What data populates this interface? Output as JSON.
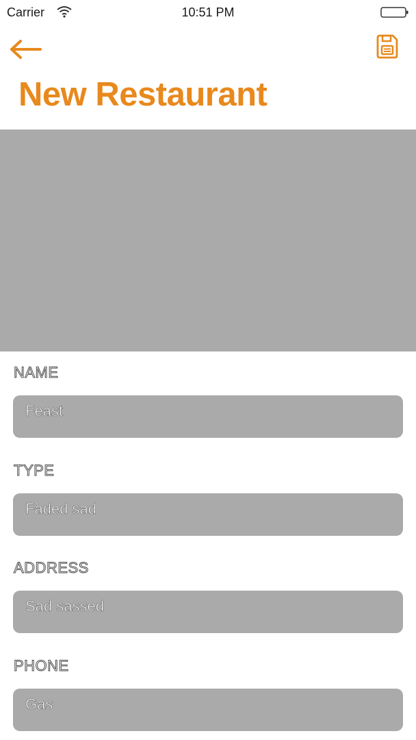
{
  "status_bar": {
    "carrier": "Carrier",
    "time": "10:51 PM",
    "icons": [
      "wifi-icon",
      "battery-icon"
    ]
  },
  "nav": {
    "back_icon": "arrow-left-icon",
    "save_icon": "floppy-disk-icon",
    "accent_color": "#e8891d"
  },
  "title": "New Restaurant",
  "image_placeholder_color": "#aaaaaa",
  "form": {
    "fields": [
      {
        "label": "NAME",
        "value": "Feast"
      },
      {
        "label": "TYPE",
        "value": "Faded sad"
      },
      {
        "label": "ADDRESS",
        "value": "Sad sassed"
      },
      {
        "label": "PHONE",
        "value": "Gas"
      }
    ]
  }
}
